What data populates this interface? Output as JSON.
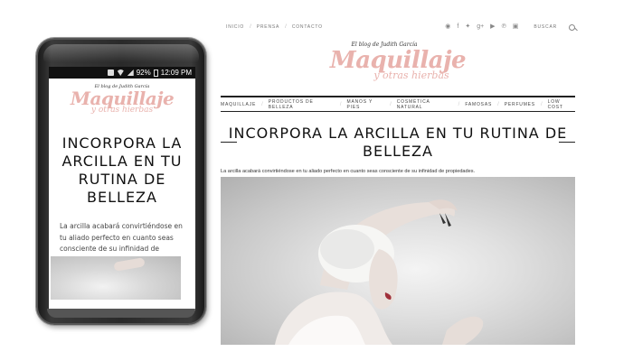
{
  "mobile": {
    "status_bar": {
      "battery": "92%",
      "time": "12:09 PM"
    },
    "tagline": "El blog de Judith García",
    "logo": "Maquillaje",
    "logo_sub": "y otras hierbas",
    "post_title": "INCORPORA LA ARCILLA EN TU RUTINA DE BELLEZA",
    "excerpt": "La arcilla acabará convirtiéndose en tu aliado perfecto en cuanto seas consciente de su infinidad de propiedades."
  },
  "desktop": {
    "top_nav": [
      "INICIO",
      "PRENSA",
      "CONTACTO"
    ],
    "social_icons": [
      "rss-icon",
      "facebook-icon",
      "twitter-icon",
      "googleplus-icon",
      "youtube-icon",
      "pinterest-icon",
      "instagram-icon"
    ],
    "search_label": "BUSCAR",
    "tagline": "El blog de Judith García",
    "logo": "Maquillaje",
    "logo_sub": "y otras hierbas",
    "categories": [
      "MAQUILLAJE",
      "PRODUCTOS DE BELLEZA",
      "MANOS Y PIES",
      "COSMÉTICA NATURAL",
      "FAMOSAS",
      "PERFUMES",
      "LOW COST"
    ],
    "post_title": "INCORPORA LA ARCILLA EN TU RUTINA DE BELLEZA",
    "excerpt": "La arcilla acabará convirtiéndose en tu aliado perfecto en cuanto seas consciente de su infinidad de propiedades."
  },
  "colors": {
    "logo_pink": "#e9b2ad",
    "text_dark": "#111111",
    "nav_text": "#777777"
  }
}
